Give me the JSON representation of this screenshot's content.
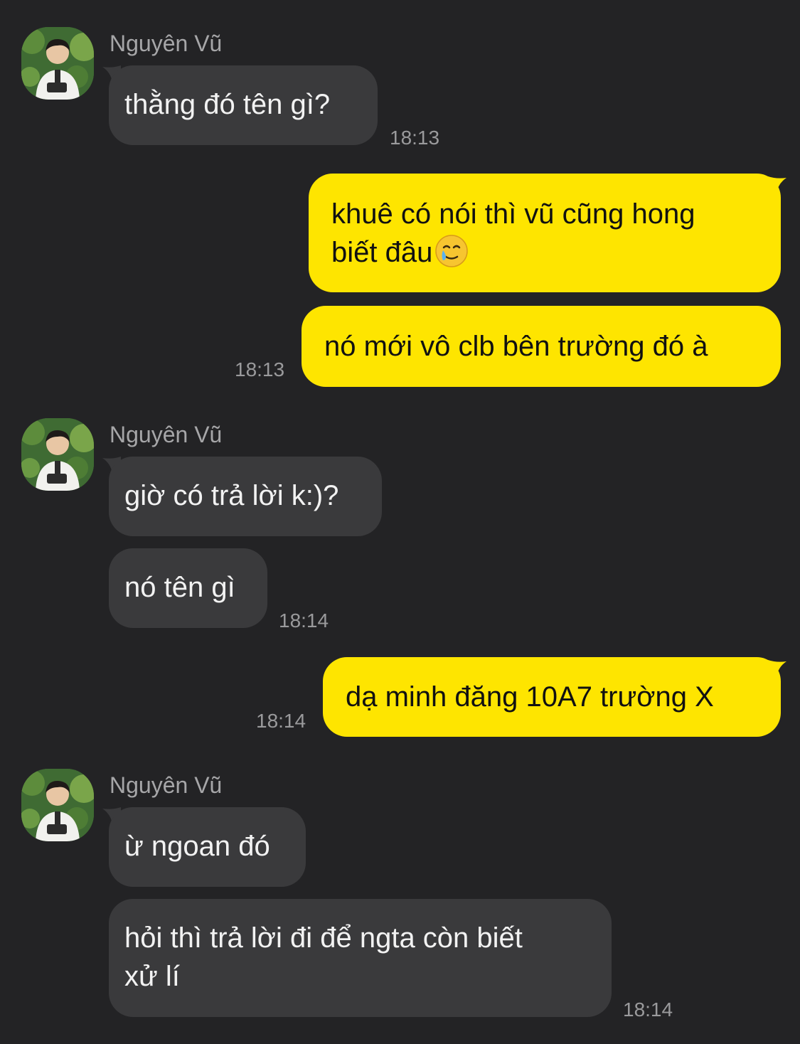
{
  "contact": {
    "name": "Nguyên Vũ"
  },
  "messages": {
    "m1": {
      "text": "thằng đó tên gì?",
      "time": "18:13"
    },
    "m2": {
      "line1": "khuê có nói thì vũ cũng hong",
      "line2": "biết đâu",
      "emoji": "crying-smile-emoji"
    },
    "m3": {
      "text": "nó mới vô clb bên trường đó à",
      "time": "18:13"
    },
    "m4": {
      "text": "giờ có trả lời k:)?"
    },
    "m5": {
      "text": "nó tên gì",
      "time": "18:14"
    },
    "m6": {
      "text": "dạ minh đăng 10A7 trường X",
      "time": "18:14"
    },
    "m7": {
      "text": "ừ ngoan đó"
    },
    "m8": {
      "line1": "hỏi thì trả lời đi để ngta còn biết",
      "line2": "xử lí",
      "time": "18:14"
    }
  },
  "colors": {
    "background": "#232325",
    "incoming_bubble": "#3a3a3c",
    "outgoing_bubble": "#fee500"
  }
}
